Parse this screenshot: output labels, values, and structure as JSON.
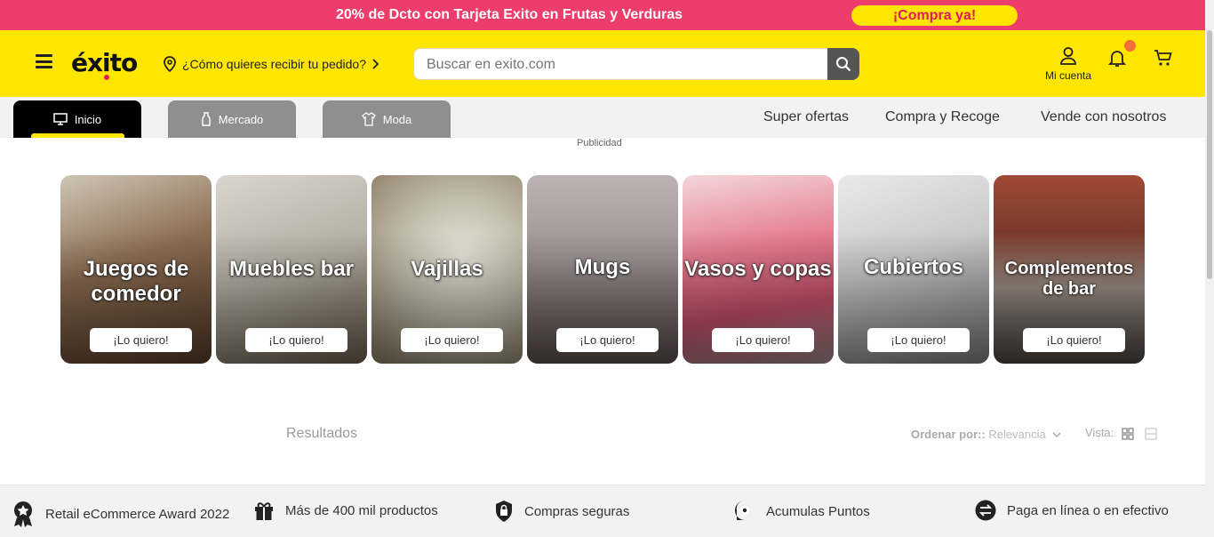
{
  "promo": {
    "text": "20% de Dcto con Tarjeta Exito en Frutas y Verduras",
    "button": "¡Compra ya!"
  },
  "header": {
    "logo": "éxito",
    "delivery": "¿Cómo quieres recibir tu pedido?",
    "search_placeholder": "Buscar en exito.com",
    "account_label": "Mi cuenta"
  },
  "nav": {
    "tabs": [
      {
        "label": "Inicio",
        "icon": "monitor-icon"
      },
      {
        "label": "Mercado",
        "icon": "bottle-icon"
      },
      {
        "label": "Moda",
        "icon": "shirt-icon"
      }
    ],
    "links": [
      "Super ofertas",
      "Compra y Recoge",
      "Vende con nosotros"
    ]
  },
  "ad_label": "Publicidad",
  "categories": [
    {
      "title": "Juegos de comedor",
      "button": "¡Lo quiero!"
    },
    {
      "title": "Muebles bar",
      "button": "¡Lo quiero!"
    },
    {
      "title": "Vajillas",
      "button": "¡Lo quiero!"
    },
    {
      "title": "Mugs",
      "button": "¡Lo quiero!"
    },
    {
      "title": "Vasos y copas",
      "button": "¡Lo quiero!"
    },
    {
      "title": "Cubiertos",
      "button": "¡Lo quiero!"
    },
    {
      "title": "Complementos de bar",
      "button": "¡Lo quiero!"
    }
  ],
  "results": {
    "label": "Resultados",
    "sort_label": "Ordenar por::",
    "sort_value": "Relevancia",
    "view_label": "Vista:"
  },
  "features": [
    {
      "label": "Retail eCommerce Award 2022",
      "icon": "award-icon"
    },
    {
      "label": "Más de 400 mil productos",
      "icon": "gift-icon"
    },
    {
      "label": "Compras seguras",
      "icon": "lock-shield-icon"
    },
    {
      "label": "Acumulas Puntos",
      "icon": "points-icon"
    },
    {
      "label": "Paga en línea o en efectivo",
      "icon": "exchange-icon"
    }
  ],
  "colors": {
    "promo": "#ec3d6b",
    "brand_yellow": "#ffe600",
    "accent": "#e5195d"
  }
}
